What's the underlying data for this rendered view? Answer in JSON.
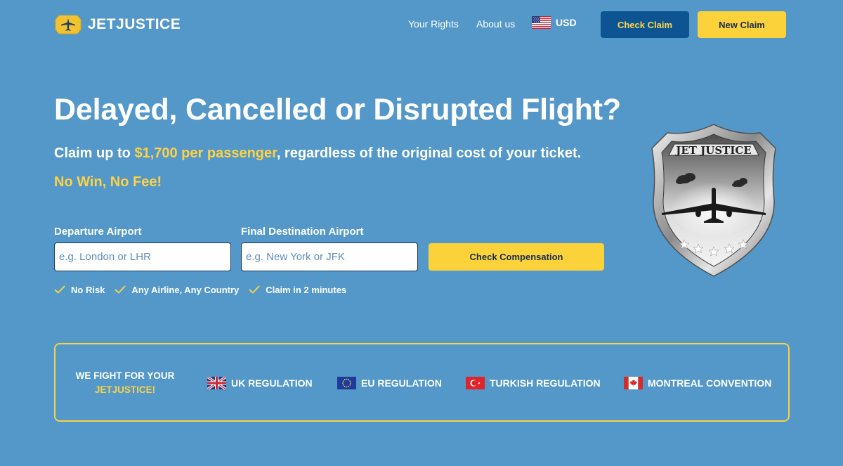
{
  "header": {
    "brand": "JETJUSTICE",
    "nav": {
      "your_rights": "Your Rights",
      "about_us": "About us"
    },
    "currency": {
      "label": "USD",
      "flag_icon": "us-flag-icon"
    },
    "buttons": {
      "check_claim": "Check Claim",
      "new_claim": "New Claim"
    }
  },
  "hero": {
    "title": "Delayed, Cancelled or Disrupted Flight?",
    "subtitle_prefix": "Claim up to ",
    "subtitle_highlight": "$1,700 per passenger",
    "subtitle_suffix": ", regardless of the original cost of your ticket.",
    "tagline": "No Win, No Fee!"
  },
  "form": {
    "departure_label": "Departure Airport",
    "departure_placeholder": "e.g. London or LHR",
    "destination_label": "Final Destination Airport",
    "destination_placeholder": "e.g. New York or JFK",
    "submit_label": "Check Compensation",
    "features": [
      {
        "label": "No Risk",
        "icon": "check-icon"
      },
      {
        "label": "Any Airline, Any Country",
        "icon": "check-icon"
      },
      {
        "label": "Claim in 2 minutes",
        "icon": "check-icon"
      }
    ]
  },
  "badge": {
    "text": "JET JUSTICE"
  },
  "regulations": {
    "fight_line1": "WE FIGHT FOR YOUR",
    "fight_line2": "JETJUSTICE!",
    "items": [
      {
        "label": "UK REGULATION",
        "icon": "uk-flag-icon"
      },
      {
        "label": "EU REGULATION",
        "icon": "eu-flag-icon"
      },
      {
        "label": "TURKISH REGULATION",
        "icon": "turkey-flag-icon"
      },
      {
        "label": "MONTREAL CONVENTION",
        "icon": "canada-flag-icon"
      }
    ]
  },
  "colors": {
    "background": "#5398c9",
    "accent_yellow": "#fcd23b",
    "navy_button": "#0c5592"
  }
}
